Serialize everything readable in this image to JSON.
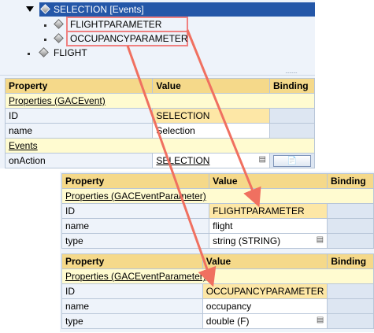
{
  "tree": {
    "selection_label": "SELECTION",
    "selection_tag": "[Events]",
    "param1": "FLIGHTPARAMETER",
    "param2": "OCCUPANCYPARAMETER",
    "flight": "FLIGHT"
  },
  "event_table": {
    "headers": {
      "property": "Property",
      "value": "Value",
      "binding": "Binding"
    },
    "section_properties": "Properties (GACEvent)",
    "id_label": "ID",
    "id_value": "SELECTION",
    "name_label": "name",
    "name_value": "Selection",
    "section_events": "Events",
    "onaction_label": "onAction",
    "onaction_value": "SELECTION"
  },
  "param_table_1": {
    "headers": {
      "property": "Property",
      "value": "Value",
      "binding": "Binding"
    },
    "section": "Properties (GACEventParameter)",
    "id_label": "ID",
    "id_value": "FLIGHTPARAMETER",
    "name_label": "name",
    "name_value": "flight",
    "type_label": "type",
    "type_value": "string (STRING)"
  },
  "param_table_2": {
    "headers": {
      "property": "Property",
      "value": "Value",
      "binding": "Binding"
    },
    "section": "Properties (GACEventParameter)",
    "id_label": "ID",
    "id_value": "OCCUPANCYPARAMETER",
    "name_label": "name",
    "name_value": "occupancy",
    "type_label": "type",
    "type_value": "double (F)"
  },
  "colors": {
    "selection_bg": "#2457a8",
    "header_bg": "#f5d98a",
    "section_bg": "#fffbd0",
    "arrow": "#f07060"
  }
}
